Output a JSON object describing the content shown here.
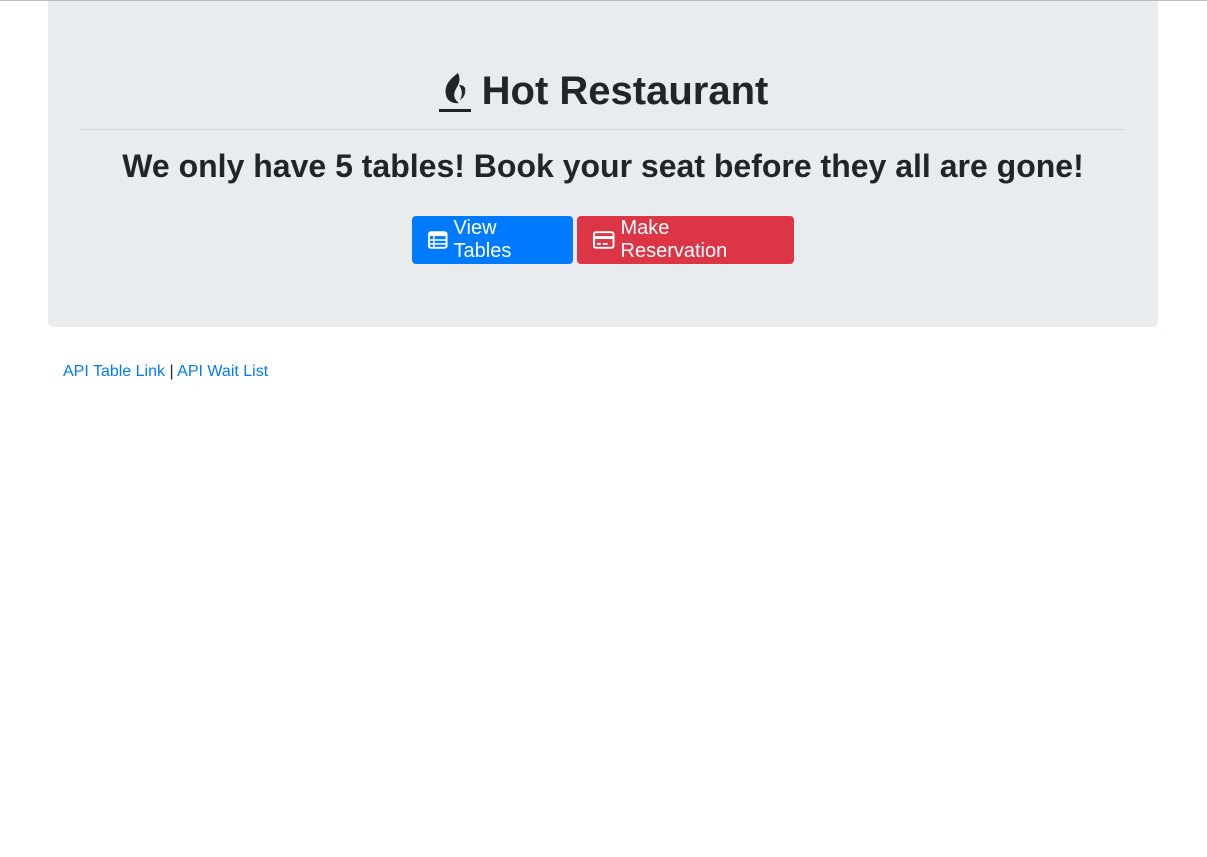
{
  "header": {
    "title": "Hot Restaurant",
    "title_icon": "fire-icon",
    "subtitle": "We only have 5 tables! Book your seat before they all are gone!"
  },
  "buttons": {
    "view_tables": {
      "label": "View Tables",
      "icon": "table-icon",
      "color": "#007bff"
    },
    "make_reservation": {
      "label": "Make Reservation",
      "icon": "credit-card-icon",
      "color": "#dc3545"
    }
  },
  "footer": {
    "api_table_link": "API Table Link",
    "separator": "|",
    "api_wait_list": "API Wait List"
  },
  "colors": {
    "jumbotron_bg": "#e9ecef",
    "link": "#007bff"
  }
}
